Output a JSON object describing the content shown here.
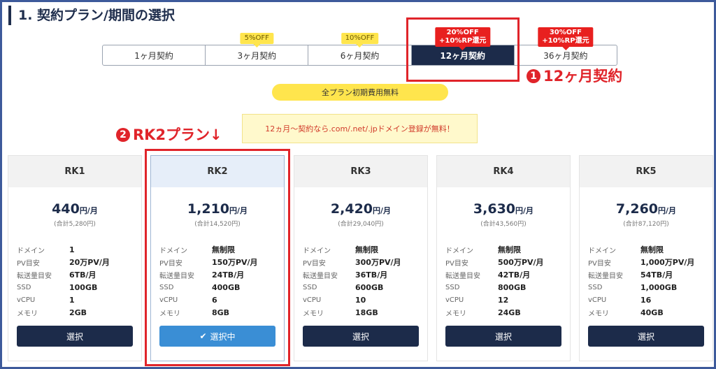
{
  "section_title": "1. 契約プラン/期間の選択",
  "tabs": [
    {
      "label": "1ヶ月契約",
      "badge": "",
      "active": false
    },
    {
      "label": "3ヶ月契約",
      "badge": "5%OFF",
      "active": false
    },
    {
      "label": "6ヶ月契約",
      "badge": "10%OFF",
      "active": false
    },
    {
      "label": "12ヶ月契約",
      "badge_line1": "20%OFF",
      "badge_line2": "+10%RP還元",
      "active": true
    },
    {
      "label": "36ヶ月契約",
      "badge_line1": "30%OFF",
      "badge_line2": "+10%RP還元",
      "active": false
    }
  ],
  "annotations": {
    "step1_num": "1",
    "step1_text": "12ヶ月契約",
    "step2_num": "2",
    "step2_text": "RK2プラン↓"
  },
  "pill_text": "全プラン初期費用無料",
  "notice_text": "12ヵ月〜契約なら.com/.net/.jpドメイン登録が無料！",
  "spec_labels": {
    "domain": "ドメイン",
    "pv": "PV目安",
    "transfer": "転送量目安",
    "ssd": "SSD",
    "vcpu": "vCPU",
    "memory": "メモリ"
  },
  "unit_text": "円/月",
  "plans": [
    {
      "name": "RK1",
      "price": "440",
      "total": "(合計5,280円)",
      "domain": "1",
      "pv": "20万PV/月",
      "transfer": "6TB/月",
      "ssd": "100GB",
      "vcpu": "1",
      "memory": "2GB",
      "button": "選択",
      "selected": false
    },
    {
      "name": "RK2",
      "price": "1,210",
      "total": "(合計14,520円)",
      "domain": "無制限",
      "pv": "150万PV/月",
      "transfer": "24TB/月",
      "ssd": "400GB",
      "vcpu": "6",
      "memory": "8GB",
      "button": "選択中",
      "selected": true
    },
    {
      "name": "RK3",
      "price": "2,420",
      "total": "(合計29,040円)",
      "domain": "無制限",
      "pv": "300万PV/月",
      "transfer": "36TB/月",
      "ssd": "600GB",
      "vcpu": "10",
      "memory": "18GB",
      "button": "選択",
      "selected": false
    },
    {
      "name": "RK4",
      "price": "3,630",
      "total": "(合計43,560円)",
      "domain": "無制限",
      "pv": "500万PV/月",
      "transfer": "42TB/月",
      "ssd": "800GB",
      "vcpu": "12",
      "memory": "24GB",
      "button": "選択",
      "selected": false
    },
    {
      "name": "RK5",
      "price": "7,260",
      "total": "(合計87,120円)",
      "domain": "無制限",
      "pv": "1,000万PV/月",
      "transfer": "54TB/月",
      "ssd": "1,000GB",
      "vcpu": "16",
      "memory": "40GB",
      "button": "選択",
      "selected": false
    }
  ],
  "colors": {
    "navy": "#1c2b4a",
    "accent_red": "#e0242a",
    "yellow": "#ffe54d",
    "selected_blue": "#3a8ed5"
  }
}
